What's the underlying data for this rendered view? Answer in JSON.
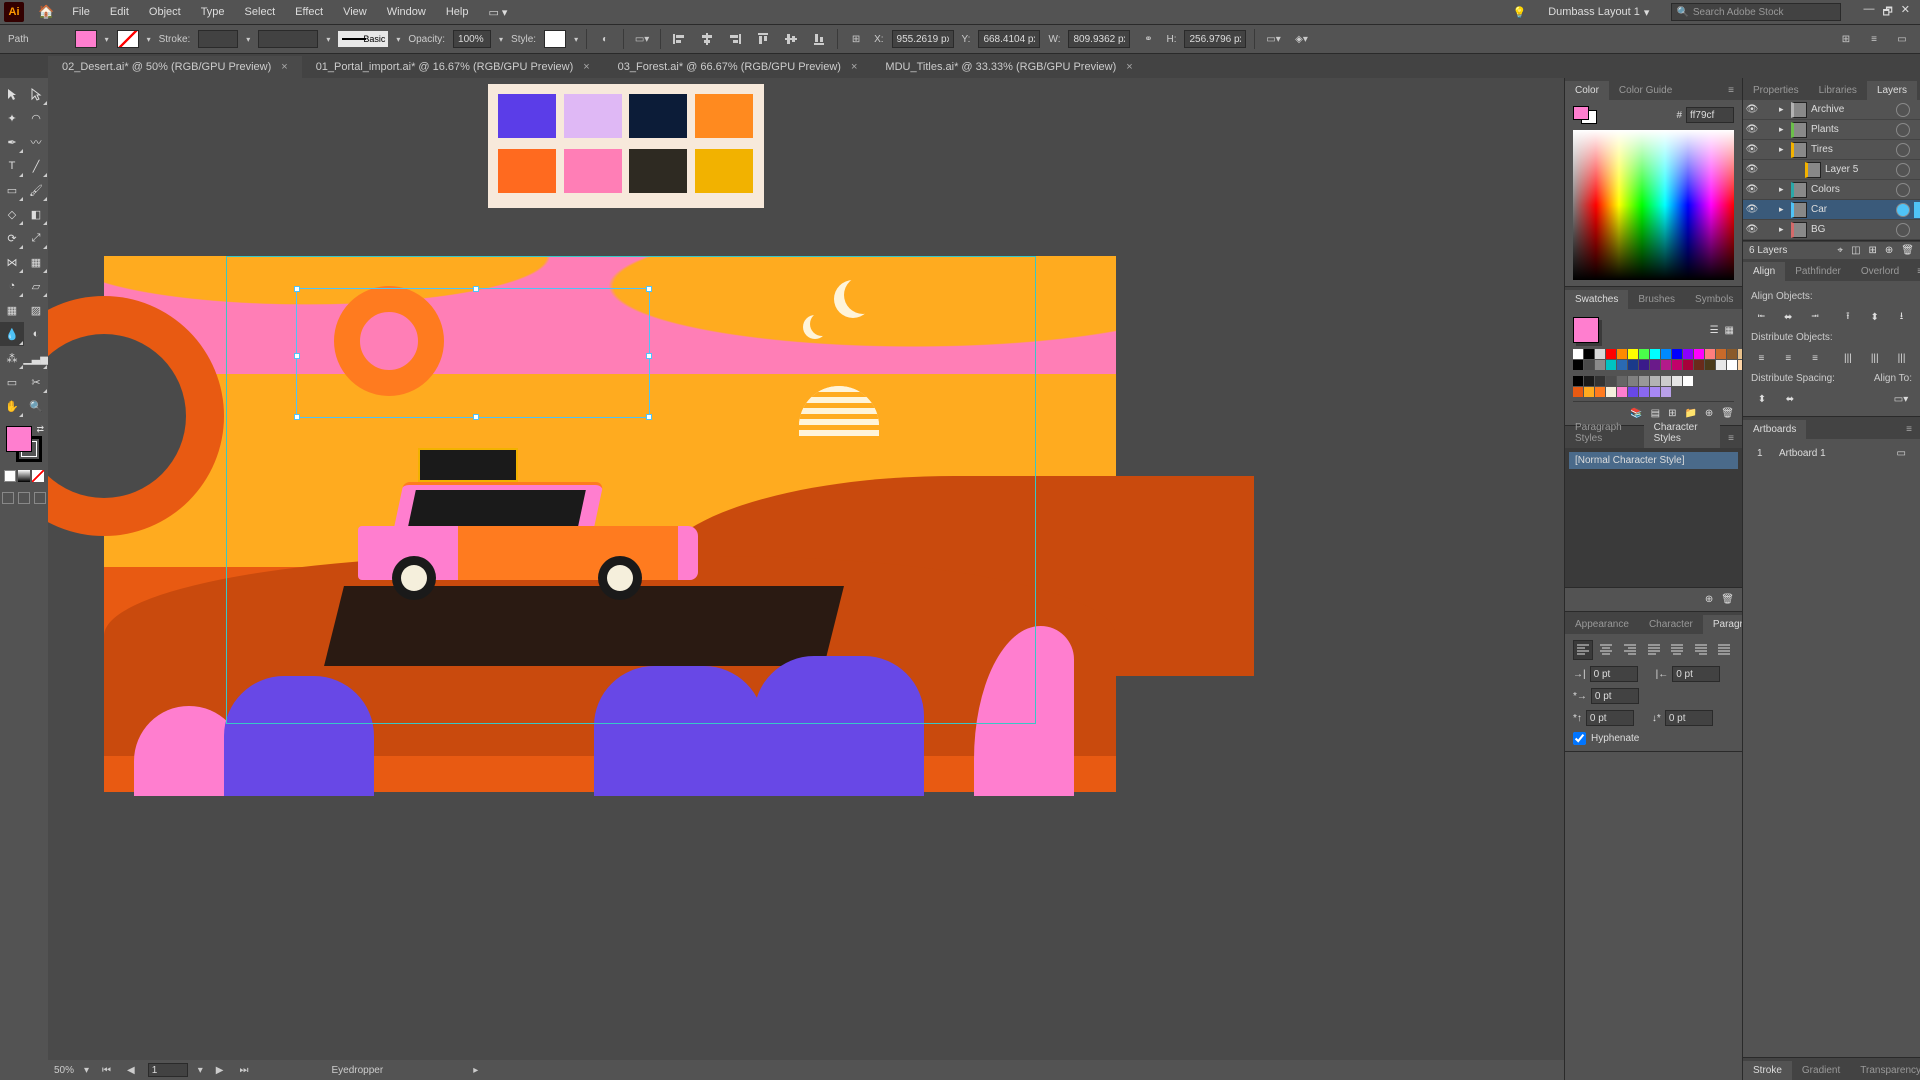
{
  "menu": {
    "items": [
      "File",
      "Edit",
      "Object",
      "Type",
      "Select",
      "Effect",
      "View",
      "Window",
      "Help"
    ]
  },
  "workspace": "Dumbass Layout 1",
  "search_placeholder": "Search Adobe Stock",
  "control": {
    "selection_label": "Path",
    "stroke_label": "Stroke:",
    "stroke_size": "",
    "stroke_profile": "Basic",
    "opacity_label": "Opacity:",
    "opacity": "100%",
    "style_label": "Style:",
    "x_label": "X:",
    "x": "955.2619 px",
    "y_label": "Y:",
    "y": "668.4104 px",
    "w_label": "W:",
    "w": "809.9362 px",
    "h_label": "H:",
    "h": "256.9796 px"
  },
  "tabs": [
    {
      "label": "02_Desert.ai* @ 50% (RGB/GPU Preview)",
      "active": true
    },
    {
      "label": "01_Portal_import.ai* @ 16.67% (RGB/GPU Preview)",
      "active": false
    },
    {
      "label": "03_Forest.ai* @ 66.67% (RGB/GPU Preview)",
      "active": false
    },
    {
      "label": "MDU_Titles.ai* @ 33.33% (RGB/GPU Preview)",
      "active": false
    }
  ],
  "palette": [
    "#5b3de8",
    "#dfb8f5",
    "#0c1c38",
    "#ff8a1f",
    "#ff6a1f",
    "#ff7eb6",
    "#2e2a22",
    "#f2b200"
  ],
  "statusbar": {
    "zoom": "50%",
    "artboard_nav": "1",
    "tool": "Eyedropper"
  },
  "color_panel": {
    "tabs": [
      "Color",
      "Color Guide"
    ],
    "hex_prefix": "#",
    "hex": "ff79cf"
  },
  "swatches_panel": {
    "tabs": [
      "Swatches",
      "Brushes",
      "Symbols"
    ]
  },
  "styles_panel": {
    "para_tab": "Paragraph Styles",
    "char_tab": "Character Styles",
    "item": "[Normal Character Style]"
  },
  "appearance_tabs": [
    "Appearance",
    "Character",
    "Paragraph"
  ],
  "paragraph": {
    "left_indent": "0 pt",
    "right_indent": "0 pt",
    "first_line": "0 pt",
    "space_before": "0 pt",
    "space_after": "0 pt",
    "hyphenate_label": "Hyphenate"
  },
  "right_tabs_top": [
    "Properties",
    "Libraries",
    "Layers"
  ],
  "layers": {
    "count_label": "6 Layers",
    "rows": [
      {
        "name": "Archive",
        "indent": 0,
        "color": "#b3b3b3",
        "expanded": false,
        "selected": false
      },
      {
        "name": "Plants",
        "indent": 0,
        "color": "#6bbf4a",
        "expanded": false,
        "selected": false
      },
      {
        "name": "Tires",
        "indent": 0,
        "color": "#f2b200",
        "expanded": true,
        "selected": false
      },
      {
        "name": "Layer 5",
        "indent": 1,
        "color": "#f2b200",
        "expanded": false,
        "selected": false,
        "sublayer": true
      },
      {
        "name": "Colors",
        "indent": 0,
        "color": "#2aa8a8",
        "expanded": false,
        "selected": false
      },
      {
        "name": "Car",
        "indent": 0,
        "color": "#4fc3f7",
        "expanded": false,
        "selected": true
      },
      {
        "name": "BG",
        "indent": 0,
        "color": "#d46a6a",
        "expanded": false,
        "selected": false
      }
    ]
  },
  "align_panel": {
    "tabs": [
      "Align",
      "Pathfinder",
      "Overlord"
    ],
    "sec1": "Align Objects:",
    "sec2": "Distribute Objects:",
    "sec3": "Distribute Spacing:",
    "align_to": "Align To:"
  },
  "artboards_panel": {
    "tab": "Artboards",
    "rows": [
      {
        "num": "1",
        "name": "Artboard 1"
      }
    ]
  },
  "stroke_tabs": [
    "Stroke",
    "Gradient",
    "Transparency"
  ],
  "swatch_colors_row1": [
    "#ffffff",
    "#000000",
    "#d8d8d8",
    "#ff0000",
    "#ff8a00",
    "#ffff00",
    "#4aff4a",
    "#00ffff",
    "#008aff",
    "#0000ff",
    "#8a00ff",
    "#ff00ff",
    "#ff7e7e",
    "#c96a2a",
    "#8a5a2a",
    "#e8c08a"
  ],
  "swatch_colors_row2": [
    "#000000",
    "#4a4a4a",
    "#8a8a8a",
    "#00c2c2",
    "#2a6ab3",
    "#1a3a8a",
    "#3a1a8a",
    "#6a1a8a",
    "#b31a8a",
    "#c2006a",
    "#a8003a",
    "#6a2a1a",
    "#4a3a1a",
    "#e8e8e8",
    "#ffffff",
    "#ffd6a8"
  ],
  "swatch_colors_row3": [
    "#000000",
    "#ffffff",
    "#2a2a2a",
    "#5a5a5a",
    "#8a8a8a",
    "#aaaaaa",
    "#c8c8c8",
    "#e0e0e0",
    "#ffffff"
  ],
  "swatch_colors_row4": [
    "#e85a12",
    "#ffab1f",
    "#ff7b1f",
    "#f5efdc",
    "#ff7ecf",
    "#6848e6",
    "#8a68f0",
    "#a888f5",
    "#b8a0e8"
  ]
}
